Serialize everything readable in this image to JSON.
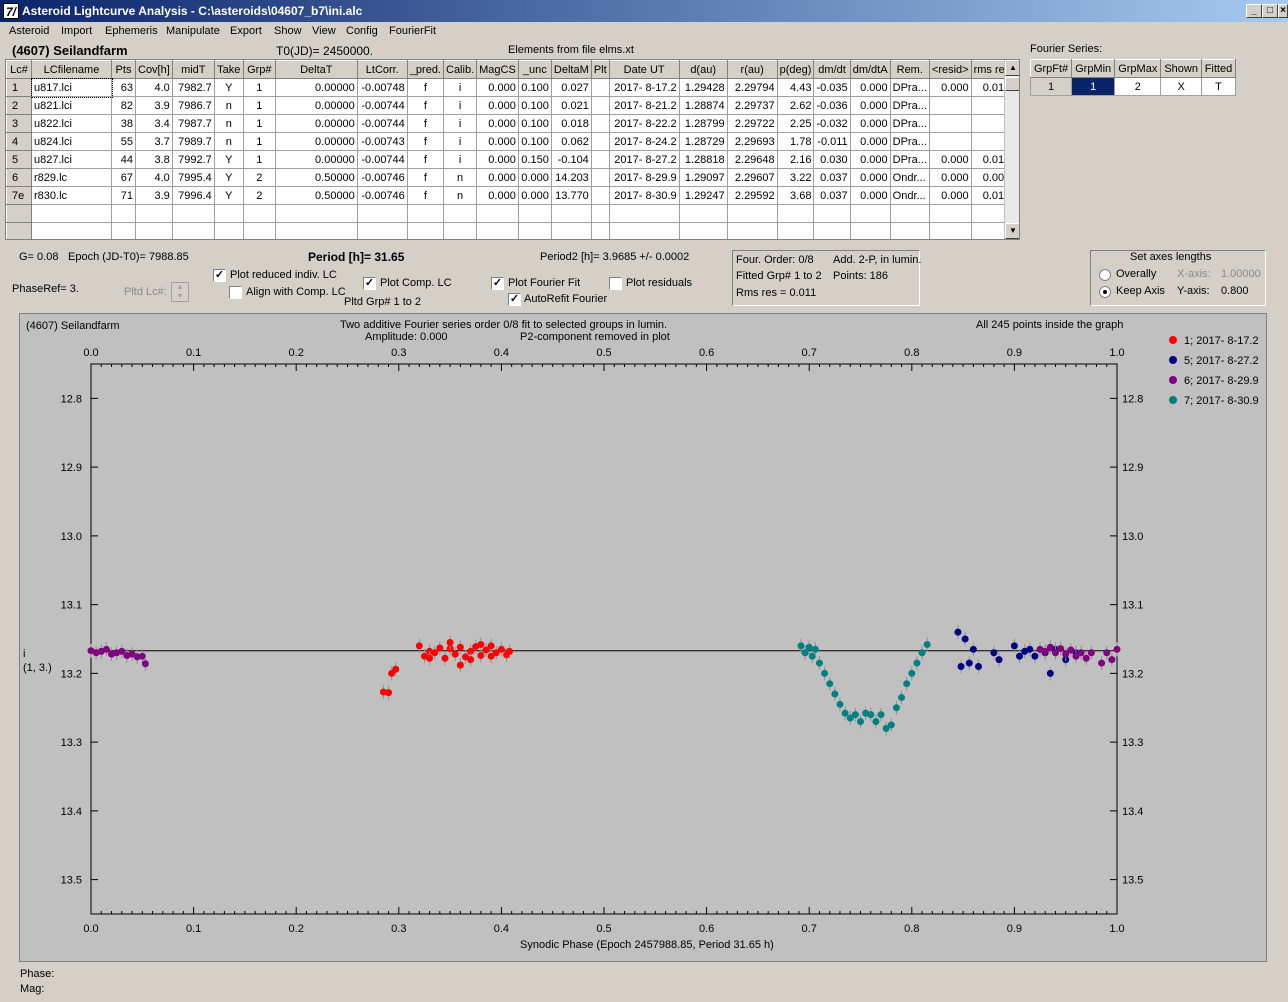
{
  "window": {
    "title": "Asteroid Lightcurve Analysis - C:\\asteroids\\04607_b7\\ini.alc",
    "icon_label": "7/",
    "min": "_",
    "max": "□",
    "close": "×"
  },
  "menu": [
    "Asteroid",
    "Import",
    "Ephemeris",
    "Manipulate",
    "Export",
    "Show",
    "View",
    "Config",
    "FourierFit"
  ],
  "header": {
    "object": "(4607) Seilandfarm",
    "t0": "T0(JD)= 2450000.",
    "elements": "Elements from file elms.xt"
  },
  "table": {
    "columns": [
      "Lc#",
      "LCfilename",
      "Pts",
      "Cov[h]",
      "midT",
      "Take",
      "Grp#",
      "DeltaT",
      "LtCorr.",
      "_pred.",
      "Calib.",
      "MagCS",
      "_unc",
      "DeltaM",
      "Plt",
      "Date UT",
      "d(au)",
      "r(au)",
      "p(deg)",
      "dm/dt",
      "dm/dtA",
      "Rem.",
      "<resid>",
      "rms res"
    ],
    "rows": [
      [
        "1",
        "u817.lci",
        "63",
        "4.0",
        "7982.7",
        "Y",
        "1",
        "0.00000",
        "-0.00748",
        "f",
        "i",
        "0.000",
        "0.100",
        "0.027",
        "",
        "2017- 8-17.2",
        "1.29428",
        "2.29794",
        "4.43",
        "-0.035",
        "0.000",
        "DPra...",
        "0.000",
        "0.010"
      ],
      [
        "2",
        "u821.lci",
        "82",
        "3.9",
        "7986.7",
        "n",
        "1",
        "0.00000",
        "-0.00744",
        "f",
        "i",
        "0.000",
        "0.100",
        "0.021",
        "",
        "2017- 8-21.2",
        "1.28874",
        "2.29737",
        "2.62",
        "-0.036",
        "0.000",
        "DPra...",
        "",
        ""
      ],
      [
        "3",
        "u822.lci",
        "38",
        "3.4",
        "7987.7",
        "n",
        "1",
        "0.00000",
        "-0.00744",
        "f",
        "i",
        "0.000",
        "0.100",
        "0.018",
        "",
        "2017- 8-22.2",
        "1.28799",
        "2.29722",
        "2.25",
        "-0.032",
        "0.000",
        "DPra...",
        "",
        ""
      ],
      [
        "4",
        "u824.lci",
        "55",
        "3.7",
        "7989.7",
        "n",
        "1",
        "0.00000",
        "-0.00743",
        "f",
        "i",
        "0.000",
        "0.100",
        "0.062",
        "",
        "2017- 8-24.2",
        "1.28729",
        "2.29693",
        "1.78",
        "-0.011",
        "0.000",
        "DPra...",
        "",
        ""
      ],
      [
        "5",
        "u827.lci",
        "44",
        "3.8",
        "7992.7",
        "Y",
        "1",
        "0.00000",
        "-0.00744",
        "f",
        "i",
        "0.000",
        "0.150",
        "-0.104",
        "",
        "2017- 8-27.2",
        "1.28818",
        "2.29648",
        "2.16",
        "0.030",
        "0.000",
        "DPra...",
        "0.000",
        "0.015"
      ],
      [
        "6",
        "r829.lc",
        "67",
        "4.0",
        "7995.4",
        "Y",
        "2",
        "0.50000",
        "-0.00746",
        "f",
        "n",
        "0.000",
        "0.000",
        "14.203",
        "",
        "2017- 8-29.9",
        "1.29097",
        "2.29607",
        "3.22",
        "0.037",
        "0.000",
        "Ondr...",
        "0.000",
        "0.006"
      ],
      [
        "7e",
        "r830.lc",
        "71",
        "3.9",
        "7996.4",
        "Y",
        "2",
        "0.50000",
        "-0.00746",
        "f",
        "n",
        "0.000",
        "0.000",
        "13.770",
        "",
        "2017- 8-30.9",
        "1.29247",
        "2.29592",
        "3.68",
        "0.037",
        "0.000",
        "Ondr...",
        "0.000",
        "0.012"
      ]
    ]
  },
  "fourier": {
    "label": "Fourier Series:",
    "columns": [
      "GrpFt#",
      "GrpMin",
      "GrpMax",
      "Shown",
      "Fitted"
    ],
    "row": [
      "1",
      "1",
      "2",
      "X",
      "T"
    ]
  },
  "info": {
    "g": "G= 0.08",
    "epoch": "Epoch (JD-T0)= 7988.85",
    "period": "Period [h]= 31.65",
    "period2": "Period2 [h]= 3.9685 +/- 0.0002",
    "phaseref": "PhaseRef= 3.",
    "pltd_lc": "Pltd Lc#:",
    "pltd_grp": "Pltd Grp#  1   to   2"
  },
  "checks": {
    "reduced": "Plot reduced indiv. LC",
    "align": "Align with Comp. LC",
    "comp": "Plot Comp. LC",
    "fourier": "Plot Fourier Fit",
    "autorefit": "AutoRefit Fourier",
    "residuals": "Plot residuals"
  },
  "fitinfo": {
    "order": "Four. Order:  0/8",
    "add": "Add. 2-P, in lumin.",
    "fitted": "Fitted Grp# 1 to 2",
    "points": "Points: 186",
    "rms": "Rms res     = 0.011"
  },
  "axes": {
    "title": "Set axes lengths",
    "overally": "Overally",
    "keep": "Keep Axis",
    "xaxis": "X-axis:",
    "xval": "1.00000",
    "yaxis": "Y-axis:",
    "yval": "0.800"
  },
  "plot": {
    "name": "(4607) Seilandfarm",
    "desc1": "Two additive Fourier series order 0/8 fit to selected groups in lumin.",
    "desc2": "Amplitude: 0.000",
    "desc3": "P2-component removed in plot",
    "inside": "All 245 points inside the graph",
    "ylabel1": "i",
    "ylabel2": "(1, 3.)",
    "xlabel": "Synodic Phase (Epoch 2457988.85, Period 31.65 h)"
  },
  "status": {
    "phase": "Phase:",
    "mag": "Mag:"
  },
  "chart_data": {
    "type": "scatter",
    "xlabel": "Synodic Phase (Epoch 2457988.85, Period 31.65 h)",
    "ylabel": "i",
    "xlim": [
      0,
      1
    ],
    "ylim": [
      13.55,
      12.75
    ],
    "xticks": [
      "0.0",
      "0.1",
      "0.2",
      "0.3",
      "0.4",
      "0.5",
      "0.6",
      "0.7",
      "0.8",
      "0.9",
      "1.0"
    ],
    "yticks": [
      "12.8",
      "12.9",
      "13.0",
      "13.1",
      "13.2",
      "13.3",
      "13.4",
      "13.5"
    ],
    "fit_line": 13.167,
    "series": [
      {
        "name": "1; 2017- 8-17.2",
        "color": "#ff0000",
        "points": [
          [
            0.285,
            13.227
          ],
          [
            0.29,
            13.228
          ],
          [
            0.293,
            13.2
          ],
          [
            0.297,
            13.194
          ],
          [
            0.32,
            13.16
          ],
          [
            0.325,
            13.175
          ],
          [
            0.33,
            13.168
          ],
          [
            0.335,
            13.17
          ],
          [
            0.34,
            13.163
          ],
          [
            0.345,
            13.178
          ],
          [
            0.35,
            13.164
          ],
          [
            0.355,
            13.172
          ],
          [
            0.36,
            13.162
          ],
          [
            0.365,
            13.176
          ],
          [
            0.37,
            13.168
          ],
          [
            0.375,
            13.161
          ],
          [
            0.38,
            13.174
          ],
          [
            0.385,
            13.166
          ],
          [
            0.39,
            13.16
          ],
          [
            0.395,
            13.17
          ],
          [
            0.4,
            13.165
          ],
          [
            0.405,
            13.173
          ],
          [
            0.408,
            13.168
          ],
          [
            0.33,
            13.178
          ],
          [
            0.35,
            13.155
          ],
          [
            0.37,
            13.18
          ],
          [
            0.39,
            13.175
          ],
          [
            0.36,
            13.188
          ],
          [
            0.38,
            13.158
          ]
        ]
      },
      {
        "name": "5; 2017- 8-27.2",
        "color": "#000080",
        "points": [
          [
            0.845,
            13.14
          ],
          [
            0.848,
            13.19
          ],
          [
            0.852,
            13.15
          ],
          [
            0.856,
            13.185
          ],
          [
            0.86,
            13.165
          ],
          [
            0.865,
            13.19
          ],
          [
            0.88,
            13.17
          ],
          [
            0.885,
            13.18
          ],
          [
            0.9,
            13.16
          ],
          [
            0.905,
            13.175
          ],
          [
            0.91,
            13.168
          ],
          [
            0.915,
            13.165
          ],
          [
            0.92,
            13.175
          ],
          [
            0.93,
            13.17
          ],
          [
            0.935,
            13.2
          ],
          [
            0.94,
            13.165
          ],
          [
            0.95,
            13.18
          ],
          [
            0.96,
            13.17
          ]
        ]
      },
      {
        "name": "6; 2017- 8-29.9",
        "color": "#800080",
        "points": [
          [
            0.0,
            13.167
          ],
          [
            0.005,
            13.17
          ],
          [
            0.01,
            13.168
          ],
          [
            0.015,
            13.165
          ],
          [
            0.02,
            13.172
          ],
          [
            0.025,
            13.17
          ],
          [
            0.03,
            13.168
          ],
          [
            0.035,
            13.174
          ],
          [
            0.04,
            13.172
          ],
          [
            0.045,
            13.176
          ],
          [
            0.05,
            13.175
          ],
          [
            0.053,
            13.186
          ],
          [
            0.925,
            13.165
          ],
          [
            0.93,
            13.168
          ],
          [
            0.935,
            13.162
          ],
          [
            0.94,
            13.17
          ],
          [
            0.945,
            13.164
          ],
          [
            0.95,
            13.172
          ],
          [
            0.955,
            13.166
          ],
          [
            0.96,
            13.175
          ],
          [
            0.965,
            13.17
          ],
          [
            0.97,
            13.178
          ],
          [
            0.975,
            13.17
          ],
          [
            0.985,
            13.185
          ],
          [
            0.99,
            13.17
          ],
          [
            0.995,
            13.18
          ],
          [
            1.0,
            13.165
          ]
        ]
      },
      {
        "name": "7; 2017- 8-30.9",
        "color": "#008080",
        "points": [
          [
            0.692,
            13.16
          ],
          [
            0.696,
            13.17
          ],
          [
            0.7,
            13.162
          ],
          [
            0.703,
            13.175
          ],
          [
            0.706,
            13.165
          ],
          [
            0.71,
            13.185
          ],
          [
            0.715,
            13.2
          ],
          [
            0.72,
            13.215
          ],
          [
            0.725,
            13.23
          ],
          [
            0.73,
            13.245
          ],
          [
            0.735,
            13.258
          ],
          [
            0.74,
            13.265
          ],
          [
            0.745,
            13.26
          ],
          [
            0.75,
            13.27
          ],
          [
            0.755,
            13.258
          ],
          [
            0.76,
            13.26
          ],
          [
            0.765,
            13.27
          ],
          [
            0.77,
            13.26
          ],
          [
            0.775,
            13.28
          ],
          [
            0.78,
            13.275
          ],
          [
            0.785,
            13.25
          ],
          [
            0.79,
            13.235
          ],
          [
            0.795,
            13.215
          ],
          [
            0.8,
            13.2
          ],
          [
            0.805,
            13.185
          ],
          [
            0.81,
            13.17
          ],
          [
            0.815,
            13.158
          ]
        ]
      }
    ]
  }
}
